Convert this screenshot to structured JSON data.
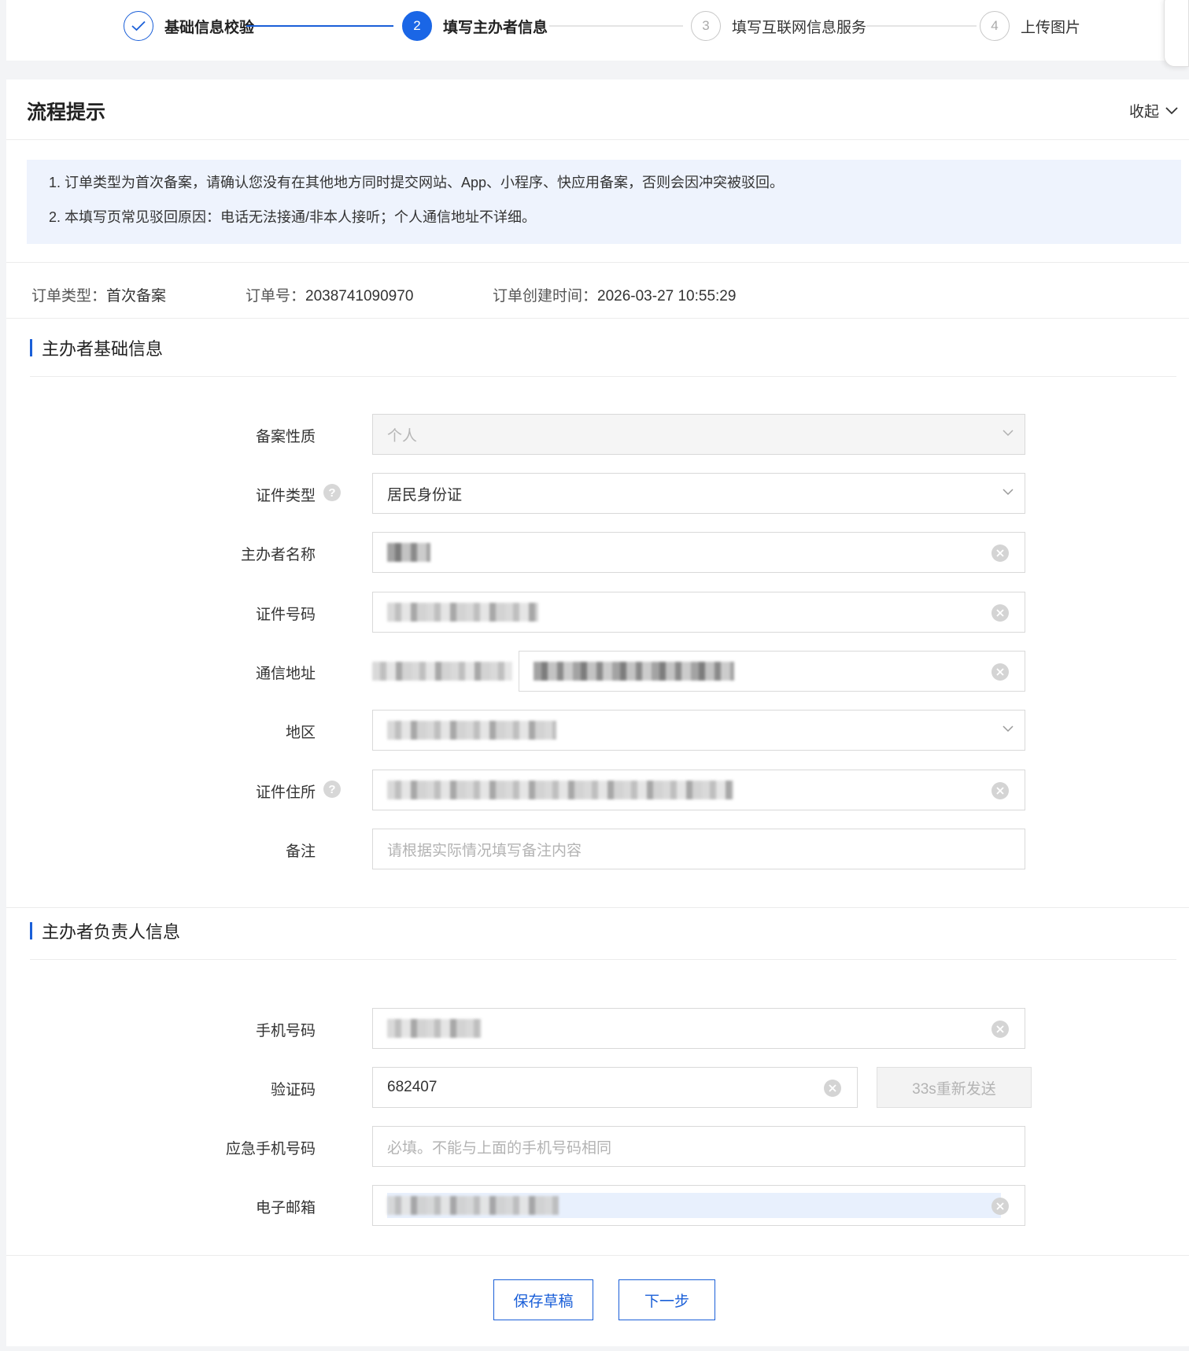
{
  "steps": [
    {
      "num": "",
      "label": "基础信息校验",
      "state": "done"
    },
    {
      "num": "2",
      "label": "填写主办者信息",
      "state": "active"
    },
    {
      "num": "3",
      "label": "填写互联网信息服务",
      "state": "pending"
    },
    {
      "num": "4",
      "label": "上传图片",
      "state": "pending"
    }
  ],
  "process_tips": {
    "title": "流程提示",
    "collapse_label": "收起",
    "items": [
      "1. 订单类型为首次备案，请确认您没有在其他地方同时提交网站、App、小程序、快应用备案，否则会因冲突被驳回。",
      "2. 本填写页常见驳回原因：电话无法接通/非本人接听；个人通信地址不详细。"
    ]
  },
  "order": {
    "type_label": "订单类型：",
    "type_value": "首次备案",
    "number_label": "订单号：",
    "number_value": "2038741090970",
    "created_label": "订单创建时间：",
    "created_value": "2026-03-27 10:55:29"
  },
  "basic_section": {
    "title": "主办者基础信息",
    "fields": {
      "nature": {
        "label": "备案性质",
        "value": "个人"
      },
      "id_type": {
        "label": "证件类型",
        "value": "居民身份证"
      },
      "name": {
        "label": "主办者名称"
      },
      "id_number": {
        "label": "证件号码"
      },
      "address": {
        "label": "通信地址"
      },
      "region": {
        "label": "地区"
      },
      "id_address": {
        "label": "证件住所"
      },
      "remark": {
        "label": "备注",
        "placeholder": "请根据实际情况填写备注内容"
      }
    }
  },
  "contact_section": {
    "title": "主办者负责人信息",
    "fields": {
      "phone": {
        "label": "手机号码"
      },
      "code": {
        "label": "验证码",
        "value": "682407",
        "resend_label": "33s重新发送"
      },
      "emergency_phone": {
        "label": "应急手机号码",
        "placeholder": "必填。不能与上面的手机号码相同"
      },
      "email": {
        "label": "电子邮箱"
      }
    }
  },
  "actions": {
    "save_draft": "保存草稿",
    "next": "下一步"
  },
  "colors": {
    "accent": "#1a5fd8",
    "tips_bg": "#eef3fd"
  }
}
